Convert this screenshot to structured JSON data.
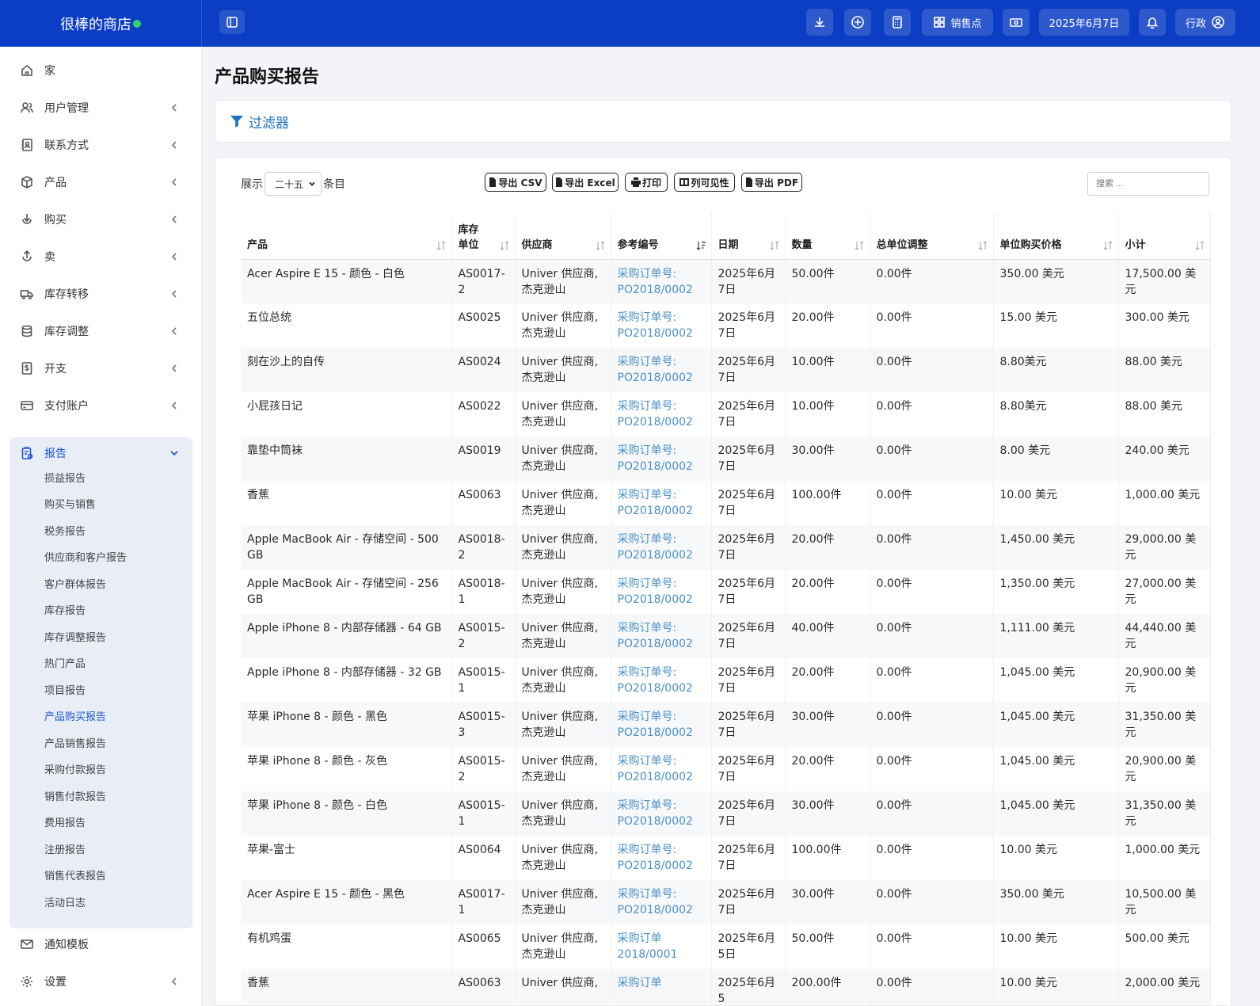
{
  "header": {
    "brand": "很棒的商店",
    "pos_label": "销售点",
    "date": "2025年6月7日",
    "user_label": "行政"
  },
  "sidebar": {
    "items": [
      {
        "label": "家",
        "icon": "home-icon",
        "chevron": false
      },
      {
        "label": "用户管理",
        "icon": "users-icon",
        "chevron": true
      },
      {
        "label": "联系方式",
        "icon": "contacts-icon",
        "chevron": true
      },
      {
        "label": "产品",
        "icon": "box-icon",
        "chevron": true
      },
      {
        "label": "购买",
        "icon": "download-circle-icon",
        "chevron": true
      },
      {
        "label": "卖",
        "icon": "upload-circle-icon",
        "chevron": true
      },
      {
        "label": "库存转移",
        "icon": "truck-icon",
        "chevron": true
      },
      {
        "label": "库存调整",
        "icon": "database-icon",
        "chevron": true
      },
      {
        "label": "开支",
        "icon": "dollar-file-icon",
        "chevron": true
      },
      {
        "label": "支付账户",
        "icon": "credit-card-icon",
        "chevron": true
      }
    ],
    "reports": {
      "label": "报告",
      "sub_items": [
        "损益报告",
        "购买与销售",
        "税务报告",
        "供应商和客户报告",
        "客户群体报告",
        "库存报告",
        "库存调整报告",
        "热门产品",
        "项目报告",
        "产品购买报告",
        "产品销售报告",
        "采购付款报告",
        "销售付款报告",
        "费用报告",
        "注册报告",
        "销售代表报告",
        "活动日志"
      ],
      "active_index": 9
    },
    "bottom_items": [
      {
        "label": "通知模板",
        "icon": "mail-icon",
        "chevron": false
      },
      {
        "label": "设置",
        "icon": "gear-icon",
        "chevron": true
      }
    ]
  },
  "main": {
    "title": "产品购买报告",
    "filter_label": "过滤器",
    "show_label": "展示",
    "show_value": "二十五",
    "entries_label": "条目",
    "search_placeholder": "搜索 ...",
    "export_buttons": [
      "导出 CSV",
      "导出 Excel",
      "打印",
      "列可见性",
      "导出 PDF"
    ]
  },
  "table": {
    "columns": [
      "产品",
      "库存单位",
      "供应商",
      "参考编号",
      "日期",
      "数量",
      "总单位调整",
      "单位购买价格",
      "小计"
    ],
    "rows": [
      {
        "product": "Acer Aspire E 15 - 颜色 - 白色",
        "sku": "AS0017-2",
        "supplier": "Univer 供应商, 杰克逊山",
        "ref": "采购订单号: PO2018/0002",
        "date": "2025年6月7日",
        "qty": "50.00件",
        "adj": "0.00件",
        "price": "350.00 美元",
        "subtotal": "17,500.00 美元"
      },
      {
        "product": "五位总统",
        "sku": "AS0025",
        "supplier": "Univer 供应商, 杰克逊山",
        "ref": "采购订单号: PO2018/0002",
        "date": "2025年6月7日",
        "qty": "20.00件",
        "adj": "0.00件",
        "price": "15.00 美元",
        "subtotal": "300.00 美元"
      },
      {
        "product": "刻在沙上的自传",
        "sku": "AS0024",
        "supplier": "Univer 供应商, 杰克逊山",
        "ref": "采购订单号: PO2018/0002",
        "date": "2025年6月7日",
        "qty": "10.00件",
        "adj": "0.00件",
        "price": "8.80美元",
        "subtotal": "88.00 美元"
      },
      {
        "product": "小屁孩日记",
        "sku": "AS0022",
        "supplier": "Univer 供应商, 杰克逊山",
        "ref": "采购订单号: PO2018/0002",
        "date": "2025年6月7日",
        "qty": "10.00件",
        "adj": "0.00件",
        "price": "8.80美元",
        "subtotal": "88.00 美元"
      },
      {
        "product": "靠垫中筒袜",
        "sku": "AS0019",
        "supplier": "Univer 供应商, 杰克逊山",
        "ref": "采购订单号: PO2018/0002",
        "date": "2025年6月7日",
        "qty": "30.00件",
        "adj": "0.00件",
        "price": "8.00 美元",
        "subtotal": "240.00 美元"
      },
      {
        "product": "香蕉",
        "sku": "AS0063",
        "supplier": "Univer 供应商, 杰克逊山",
        "ref": "采购订单号: PO2018/0002",
        "date": "2025年6月7日",
        "qty": "100.00件",
        "adj": "0.00件",
        "price": "10.00 美元",
        "subtotal": "1,000.00 美元"
      },
      {
        "product": "Apple MacBook Air - 存储空间 - 500 GB",
        "sku": "AS0018-2",
        "supplier": "Univer 供应商, 杰克逊山",
        "ref": "采购订单号: PO2018/0002",
        "date": "2025年6月7日",
        "qty": "20.00件",
        "adj": "0.00件",
        "price": "1,450.00 美元",
        "subtotal": "29,000.00 美元"
      },
      {
        "product": "Apple MacBook Air - 存储空间 - 256 GB",
        "sku": "AS0018-1",
        "supplier": "Univer 供应商, 杰克逊山",
        "ref": "采购订单号: PO2018/0002",
        "date": "2025年6月7日",
        "qty": "20.00件",
        "adj": "0.00件",
        "price": "1,350.00 美元",
        "subtotal": "27,000.00 美元"
      },
      {
        "product": "Apple iPhone 8 - 内部存储器 - 64 GB",
        "sku": "AS0015-2",
        "supplier": "Univer 供应商, 杰克逊山",
        "ref": "采购订单号: PO2018/0002",
        "date": "2025年6月7日",
        "qty": "40.00件",
        "adj": "0.00件",
        "price": "1,111.00 美元",
        "subtotal": "44,440.00 美元"
      },
      {
        "product": "Apple iPhone 8 - 内部存储器 - 32 GB",
        "sku": "AS0015-1",
        "supplier": "Univer 供应商, 杰克逊山",
        "ref": "采购订单号: PO2018/0002",
        "date": "2025年6月7日",
        "qty": "20.00件",
        "adj": "0.00件",
        "price": "1,045.00 美元",
        "subtotal": "20,900.00 美元"
      },
      {
        "product": "苹果 iPhone 8 - 颜色 - 黑色",
        "sku": "AS0015-3",
        "supplier": "Univer 供应商, 杰克逊山",
        "ref": "采购订单号: PO2018/0002",
        "date": "2025年6月7日",
        "qty": "30.00件",
        "adj": "0.00件",
        "price": "1,045.00 美元",
        "subtotal": "31,350.00 美元"
      },
      {
        "product": "苹果 iPhone 8 - 颜色 - 灰色",
        "sku": "AS0015-2",
        "supplier": "Univer 供应商, 杰克逊山",
        "ref": "采购订单号: PO2018/0002",
        "date": "2025年6月7日",
        "qty": "20.00件",
        "adj": "0.00件",
        "price": "1,045.00 美元",
        "subtotal": "20,900.00 美元"
      },
      {
        "product": "苹果 iPhone 8 - 颜色 - 白色",
        "sku": "AS0015-1",
        "supplier": "Univer 供应商, 杰克逊山",
        "ref": "采购订单号: PO2018/0002",
        "date": "2025年6月7日",
        "qty": "30.00件",
        "adj": "0.00件",
        "price": "1,045.00 美元",
        "subtotal": "31,350.00 美元"
      },
      {
        "product": "苹果-富士",
        "sku": "AS0064",
        "supplier": "Univer 供应商, 杰克逊山",
        "ref": "采购订单号: PO2018/0002",
        "date": "2025年6月7日",
        "qty": "100.00件",
        "adj": "0.00件",
        "price": "10.00 美元",
        "subtotal": "1,000.00 美元"
      },
      {
        "product": "Acer Aspire E 15 - 颜色 - 黑色",
        "sku": "AS0017-1",
        "supplier": "Univer 供应商, 杰克逊山",
        "ref": "采购订单号: PO2018/0002",
        "date": "2025年6月7日",
        "qty": "30.00件",
        "adj": "0.00件",
        "price": "350.00 美元",
        "subtotal": "10,500.00 美元"
      },
      {
        "product": "有机鸡蛋",
        "sku": "AS0065",
        "supplier": "Univer 供应商, 杰克逊山",
        "ref": "采购订单 2018/0001",
        "date": "2025年6月5日",
        "qty": "50.00件",
        "adj": "0.00件",
        "price": "10.00 美元",
        "subtotal": "500.00 美元"
      },
      {
        "product": "香蕉",
        "sku": "AS0063",
        "supplier": "Univer 供应商,",
        "ref": "采购订单",
        "date": "2025年6月5",
        "qty": "200.00件",
        "adj": "0.00件",
        "price": "10.00 美元",
        "subtotal": "2,000.00 美元"
      }
    ]
  },
  "colors": {
    "topbar": "#0b3ec4",
    "accent": "#1a56db",
    "link": "#4a90c8",
    "online": "#2bd46b"
  }
}
